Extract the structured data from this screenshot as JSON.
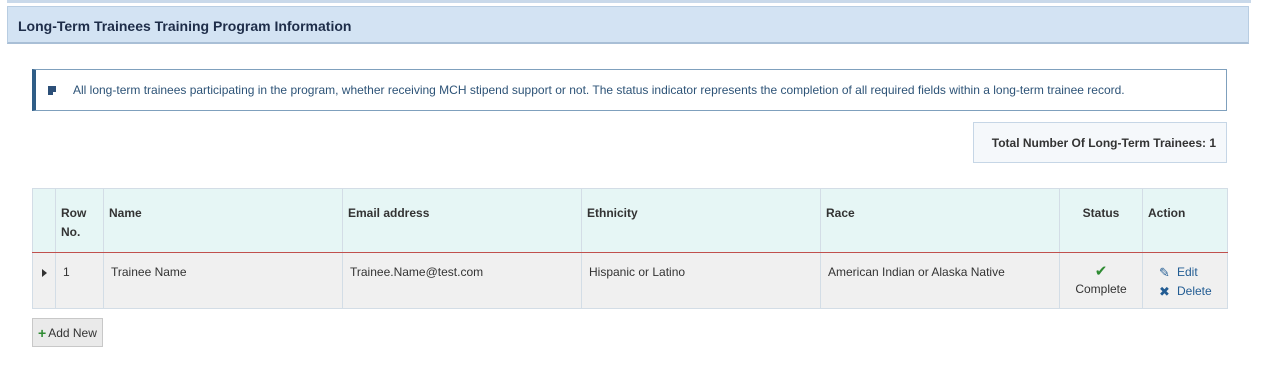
{
  "panel": {
    "title": "Long-Term Trainees Training Program Information"
  },
  "info": {
    "icon": "note-icon",
    "text": "All long-term trainees participating in the program, whether receiving MCH stipend support or not. The status indicator represents the completion of all required fields within a long-term trainee record."
  },
  "summary": {
    "total_label": "Total Number Of Long-Term Trainees: 1"
  },
  "table": {
    "headers": {
      "row_no": "Row No.",
      "name": "Name",
      "email": "Email address",
      "ethnicity": "Ethnicity",
      "race": "Race",
      "status": "Status",
      "action": "Action"
    },
    "rows": [
      {
        "row_no": "1",
        "name": "Trainee Name",
        "email": "Trainee.Name@test.com",
        "ethnicity": "Hispanic or Latino",
        "race": "American Indian or Alaska Native",
        "status_icon": "check-icon",
        "status": "Complete",
        "edit_label": "Edit",
        "delete_label": "Delete"
      }
    ]
  },
  "buttons": {
    "add_new": "Add New"
  },
  "colors": {
    "header_bg": "#d3e3f3",
    "table_header_bg": "#e6f6f5",
    "accent_line": "#c0504d",
    "check": "#2e8b32",
    "link": "#225c93"
  }
}
